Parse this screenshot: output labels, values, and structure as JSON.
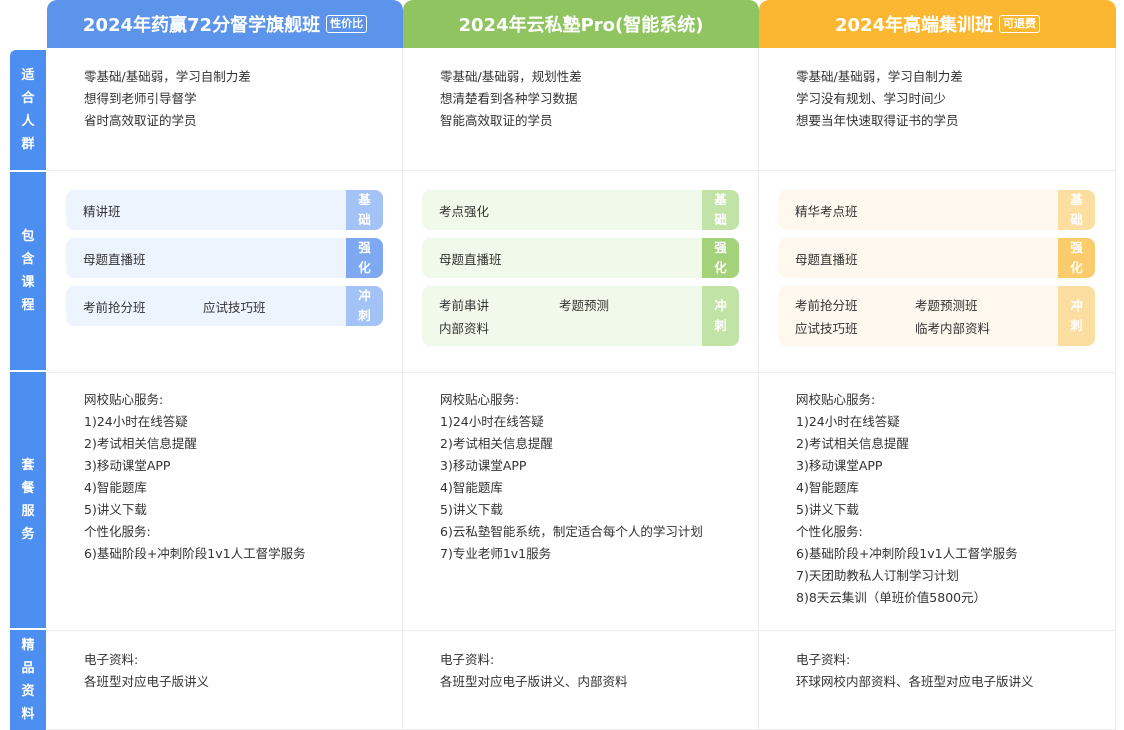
{
  "plans": [
    {
      "title": "2024年药赢72分督学旗舰班",
      "tag": "性价比",
      "color": "#5b94ea"
    },
    {
      "title": "2024年云私塾Pro(智能系统)",
      "tag": "",
      "color": "#8fc461"
    },
    {
      "title": "2024年高端集训班",
      "tag": "可退费",
      "color": "#fbb731"
    }
  ],
  "rows": {
    "audience": "适合人群",
    "courses": "包含课程",
    "services": "套餐服务",
    "materials": "精品资料"
  },
  "audience": [
    [
      "零基础/基础弱，学习自制力差",
      "想得到老师引导督学",
      "省时高效取证的学员"
    ],
    [
      "零基础/基础弱，规划性差",
      "想清楚看到各种学习数据",
      "智能高效取证的学员"
    ],
    [
      "零基础/基础弱，学习自制力差",
      "学习没有规划、学习时间少",
      "想要当年快速取得证书的学员"
    ]
  ],
  "badges": {
    "basic": "基础",
    "strong": "强化",
    "sprint": "冲刺"
  },
  "courses": [
    {
      "basic": [
        "精讲班"
      ],
      "strong": [
        "母题直播班"
      ],
      "sprint": [
        "考前抢分班",
        "应试技巧班"
      ]
    },
    {
      "basic": [
        "考点强化"
      ],
      "strong": [
        "母题直播班"
      ],
      "sprint": [
        "考前串讲",
        "考题预测",
        "内部资料"
      ]
    },
    {
      "basic": [
        "精华考点班"
      ],
      "strong": [
        "母题直播班"
      ],
      "sprint": [
        "考前抢分班",
        "考题预测班",
        "应试技巧班",
        "临考内部资料"
      ]
    }
  ],
  "services": [
    [
      "网校贴心服务:",
      "1)24小时在线答疑",
      "2)考试相关信息提醒",
      "3)移动课堂APP",
      "4)智能题库",
      "5)讲义下载",
      "个性化服务:",
      "6)基础阶段+冲刺阶段1v1人工督学服务"
    ],
    [
      "网校贴心服务:",
      "1)24小时在线答疑",
      "2)考试相关信息提醒",
      "3)移动课堂APP",
      "4)智能题库",
      "5)讲义下载",
      "6)云私塾智能系统，制定适合每个人的学习计划",
      "7)专业老师1v1服务"
    ],
    [
      "网校贴心服务:",
      "1)24小时在线答疑",
      "2)考试相关信息提醒",
      "3)移动课堂APP",
      "4)智能题库",
      "5)讲义下载",
      "个性化服务:",
      "6)基础阶段+冲刺阶段1v1人工督学服务",
      "7)天团助教私人订制学习计划",
      "8)8天云集训（单班价值5800元）"
    ]
  ],
  "materials": [
    [
      "电子资料:",
      "各班型对应电子版讲义"
    ],
    [
      "电子资料:",
      "各班型对应电子版讲义、内部资料"
    ],
    [
      "电子资料:",
      "环球网校内部资料、各班型对应电子版讲义"
    ]
  ],
  "colors": {
    "row_label": "#4d8ff0",
    "blue_pill": "#eef4fd",
    "blue_badges": [
      "#a3c3f7",
      "#7ea9f1",
      "#a3c3f7"
    ],
    "green_pill": "#f1faea",
    "green_badges": [
      "#c2e3a6",
      "#a3d27a",
      "#c2e3a6"
    ],
    "orange_pill": "#fff8ef",
    "orange_badges": [
      "#fcdfa0",
      "#fbcc6c",
      "#fcdfa0"
    ]
  }
}
